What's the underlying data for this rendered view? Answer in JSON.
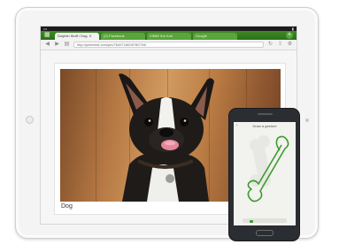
{
  "browser": {
    "tabs": [
      {
        "label": "Dolphin Stuff / Dog. X",
        "active": true
      },
      {
        "label": "(2) Facebook",
        "active": false
      },
      {
        "label": "VIMM' the Koh",
        "active": false
      },
      {
        "label": "Google",
        "active": false
      }
    ],
    "url": "http://pinterest.com/pin/7649718005780754/"
  },
  "page": {
    "caption": "Dog"
  },
  "phone": {
    "title": "Draw a gesture"
  },
  "colors": {
    "tab_bar_green": "#2d6e19",
    "gesture_green": "#3c9b2f"
  },
  "icons": {
    "tab_grid": "grid-icon",
    "new_tab": "plus-icon",
    "back": "back-icon",
    "forward": "forward-icon",
    "refresh": "refresh-icon",
    "share": "share-icon",
    "settings": "gear-icon",
    "bookmark": "bookmark-icon"
  }
}
